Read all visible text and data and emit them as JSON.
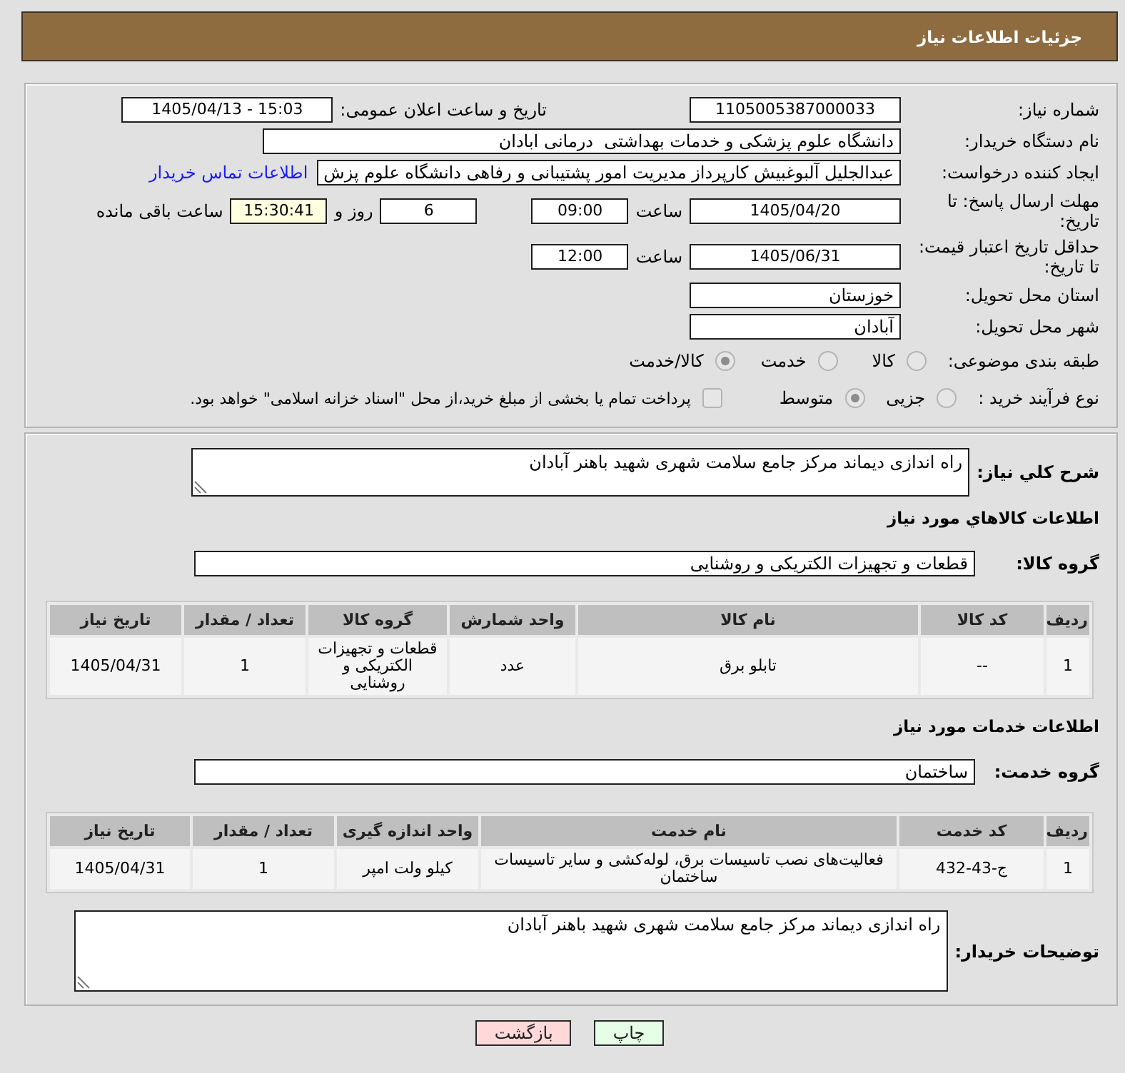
{
  "header": {
    "title": "جزئیات اطلاعات نیاز"
  },
  "need_info": {
    "need_number": {
      "label": "شماره نیاز:",
      "value": "1105005387000033"
    },
    "announcement": {
      "label": "تاریخ و ساعت اعلان عمومی:",
      "value": "1405/04/13 - 15:03"
    },
    "buyer_org": {
      "label": "نام دستگاه خریدار:",
      "value": "دانشگاه علوم پزشکی و خدمات بهداشتی  درمانی ابادان"
    },
    "requester": {
      "label": "ایجاد کننده درخواست:",
      "value": "عبدالجلیل آلبوغبیش کارپرداز مدیریت امور پشتیبانی و رفاهی دانشگاه علوم پزش",
      "contact_link": "اطلاعات تماس خریدار"
    },
    "response_deadline": {
      "label": "مهلت ارسال پاسخ: تا تاریخ:",
      "date": "1405/04/20",
      "time_label": "ساعت",
      "time": "09:00",
      "days": "6",
      "days_label": "روز و",
      "remaining": "15:30:41",
      "remaining_label": "ساعت باقی مانده"
    },
    "price_validity": {
      "label": "حداقل تاریخ اعتبار قیمت: تا تاریخ:",
      "date": "1405/06/31",
      "time_label": "ساعت",
      "time": "12:00"
    },
    "delivery_province": {
      "label": "استان محل تحویل:",
      "value": "خوزستان"
    },
    "delivery_city": {
      "label": "شهر محل تحویل:",
      "value": "آبادان"
    },
    "category": {
      "label": "طبقه بندی موضوعی:",
      "options": [
        {
          "label": "کالا",
          "selected": false
        },
        {
          "label": "خدمت",
          "selected": false
        },
        {
          "label": "کالا/خدمت",
          "selected": true
        }
      ]
    },
    "purchase_process": {
      "label": "نوع فرآیند خرید :",
      "options": [
        {
          "label": "جزیی",
          "selected": false
        },
        {
          "label": "متوسط",
          "selected": true
        }
      ],
      "treasury_option": {
        "label": "پرداخت تمام یا بخشی از مبلغ خرید،از محل \"اسناد خزانه اسلامی\" خواهد بود.",
        "checked": false
      }
    }
  },
  "description": {
    "label": "شرح کلي نیاز:",
    "value": "راه اندازی دیماند مرکز جامع سلامت شهری شهید باهنر آبادان"
  },
  "goods": {
    "heading": "اطلاعات کالاهاي مورد نیاز",
    "group_label": "گروه کالا:",
    "group_value": "قطعات و تجهیزات الکتریکی و روشنایی",
    "table": {
      "columns": [
        "ردیف",
        "کد کالا",
        "نام کالا",
        "واحد شمارش",
        "گروه کالا",
        "تعداد / مقدار",
        "تاریخ نیاز"
      ],
      "rows": [
        [
          "1",
          "--",
          "تابلو برق",
          "عدد",
          "قطعات و تجهیزات الکتریکی و روشنایی",
          "1",
          "1405/04/31"
        ]
      ]
    }
  },
  "services": {
    "heading": "اطلاعات خدمات مورد نیاز",
    "group_label": "گروه خدمت:",
    "group_value": "ساختمان",
    "table": {
      "columns": [
        "ردیف",
        "کد خدمت",
        "نام خدمت",
        "واحد اندازه گیری",
        "تعداد / مقدار",
        "تاریخ نیاز"
      ],
      "rows": [
        [
          "1",
          "ج-43-432",
          "فعالیت‌های نصب تاسیسات برق، لوله‌کشی و سایر تاسیسات ساختمان",
          "کیلو ولت امپر",
          "1",
          "1405/04/31"
        ]
      ]
    }
  },
  "buyer_notes": {
    "label": "توضیحات خریدار:",
    "value": "راه اندازی دیماند مرکز جامع سلامت شهری شهید باهنر آبادان"
  },
  "buttons": [
    {
      "label": "چاپ",
      "kind": "print"
    },
    {
      "label": "بازگشت",
      "kind": "back"
    }
  ]
}
